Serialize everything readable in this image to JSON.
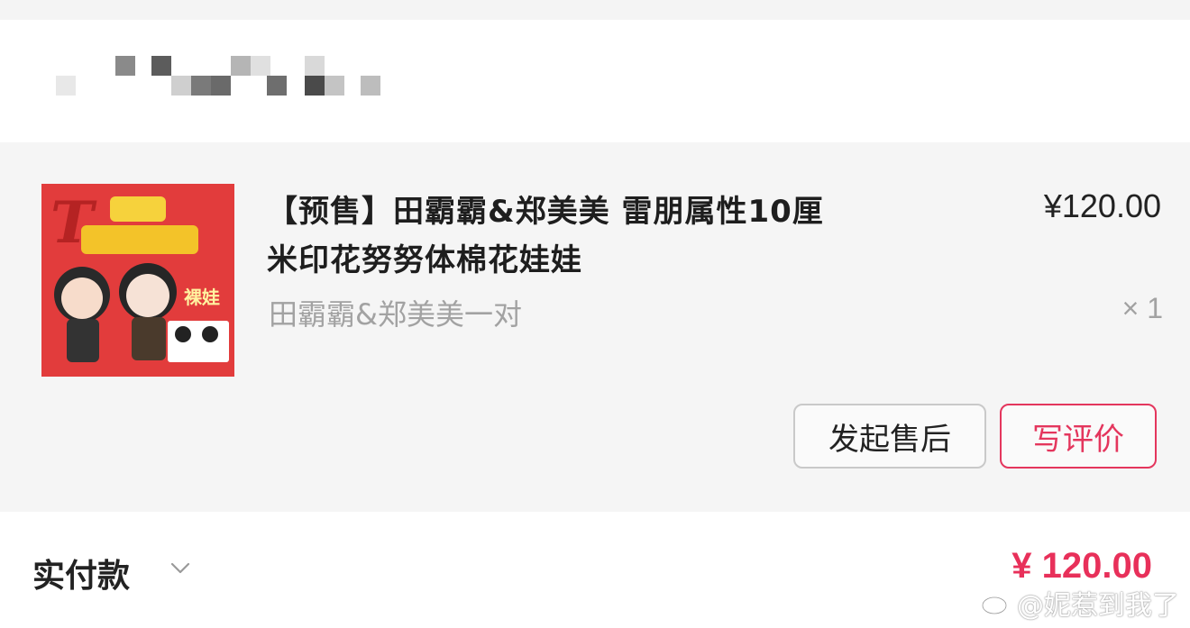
{
  "product": {
    "title": "【预售】田霸霸&郑美美  雷朋属性10厘米印花努努体棉花娃娃",
    "price": "¥120.00",
    "variant": "田霸霸&郑美美一对",
    "quantity": "× 1",
    "thumbnail": {
      "letter": "T",
      "tag": "裸娃"
    }
  },
  "actions": {
    "after_sales_label": "发起售后",
    "review_label": "写评价"
  },
  "payment": {
    "label": "实付款",
    "amount": "¥ 120.00"
  },
  "watermark": {
    "text": "@妮惹到我了"
  },
  "colors": {
    "accent": "#e4365d",
    "price_red": "#e8305a",
    "card_background": "#f5f5f5",
    "thumbnail_red": "#e23c3c"
  }
}
